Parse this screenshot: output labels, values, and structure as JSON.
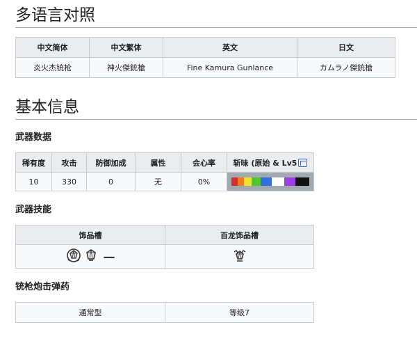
{
  "sections": {
    "multilang_title": "多语言对照",
    "basic_title": "基本信息"
  },
  "lang_table": {
    "headers": [
      "中文简体",
      "中文繁体",
      "英文",
      "日文"
    ],
    "values": [
      "炎火杰铳枪",
      "神火傑銃槍",
      "Fine Kamura Gunlance",
      "カムラノ傑銃槍"
    ]
  },
  "weapon_data": {
    "title": "武器数据",
    "headers": [
      "稀有度",
      "攻击",
      "防御加成",
      "属性",
      "会心率",
      "斩味 (原始 & Lv5"
    ],
    "values": [
      "10",
      "330",
      "0",
      "无",
      "0%"
    ],
    "sharpness": [
      {
        "color": "#d92c2c",
        "fraction": 0.08
      },
      {
        "color": "#f07c22",
        "fraction": 0.08
      },
      {
        "color": "#f2e22b",
        "fraction": 0.1
      },
      {
        "color": "#51c431",
        "fraction": 0.12
      },
      {
        "color": "#2f6fe0",
        "fraction": 0.14
      },
      {
        "color": "#ffffff",
        "fraction": 0.16
      },
      {
        "color": "#9b3fe0",
        "fraction": 0.14
      },
      {
        "color": "#111111",
        "fraction": 0.18
      }
    ]
  },
  "weapon_skills": {
    "title": "武器技能",
    "headers": [
      "饰品槽",
      "百龙饰品槽"
    ],
    "deco_dash": "一"
  },
  "ammo": {
    "title": "铳枪炮击弹药",
    "type": "通常型",
    "level": "等级7"
  },
  "icons": {
    "edit": "edit-icon",
    "deco_slot": "jewel-slot-icon",
    "rampage_slot": "rampage-slot-icon"
  }
}
